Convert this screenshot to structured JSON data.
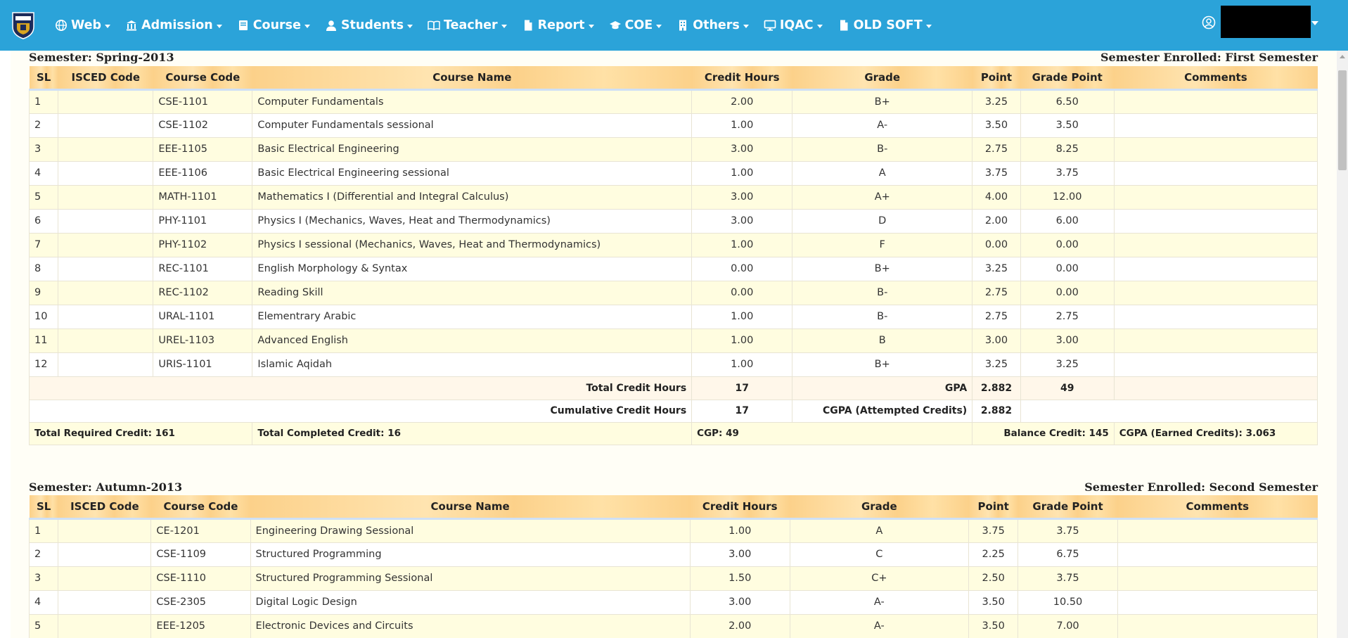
{
  "nav": {
    "items": [
      {
        "label": "Web",
        "icon": "globe-icon"
      },
      {
        "label": "Admission",
        "icon": "institution-icon"
      },
      {
        "label": "Course",
        "icon": "book-icon"
      },
      {
        "label": "Students",
        "icon": "user-icon"
      },
      {
        "label": "Teacher",
        "icon": "open-book-icon"
      },
      {
        "label": "Report",
        "icon": "file-icon"
      },
      {
        "label": "COE",
        "icon": "graduation-cap-icon"
      },
      {
        "label": "Others",
        "icon": "building-icon"
      },
      {
        "label": "IQAC",
        "icon": "desktop-icon"
      },
      {
        "label": "OLD SOFT",
        "icon": "file-icon"
      }
    ]
  },
  "colors": {
    "navbar": "#2ba3d9",
    "header_row": "#fcd18a",
    "odd_row": "#fffde0"
  },
  "columns": [
    "SL",
    "ISCED Code",
    "Course Code",
    "Course Name",
    "Credit Hours",
    "Grade",
    "Point",
    "Grade Point",
    "Comments"
  ],
  "semesters": [
    {
      "label": "Semester: Spring-2013",
      "enrolled": "Semester Enrolled: First Semester",
      "rows": [
        {
          "sl": "1",
          "isced": "",
          "code": "CSE-1101",
          "name": "Computer Fundamentals",
          "credit": "2.00",
          "grade": "B+",
          "point": "3.25",
          "gp": "6.50",
          "comments": ""
        },
        {
          "sl": "2",
          "isced": "",
          "code": "CSE-1102",
          "name": "Computer Fundamentals sessional",
          "credit": "1.00",
          "grade": "A-",
          "point": "3.50",
          "gp": "3.50",
          "comments": ""
        },
        {
          "sl": "3",
          "isced": "",
          "code": "EEE-1105",
          "name": "Basic Electrical Engineering",
          "credit": "3.00",
          "grade": "B-",
          "point": "2.75",
          "gp": "8.25",
          "comments": ""
        },
        {
          "sl": "4",
          "isced": "",
          "code": "EEE-1106",
          "name": "Basic Electrical Engineering sessional",
          "credit": "1.00",
          "grade": "A",
          "point": "3.75",
          "gp": "3.75",
          "comments": ""
        },
        {
          "sl": "5",
          "isced": "",
          "code": "MATH-1101",
          "name": "Mathematics I (Differential and Integral Calculus)",
          "credit": "3.00",
          "grade": "A+",
          "point": "4.00",
          "gp": "12.00",
          "comments": ""
        },
        {
          "sl": "6",
          "isced": "",
          "code": "PHY-1101",
          "name": "Physics I (Mechanics, Waves, Heat and Thermodynamics)",
          "credit": "3.00",
          "grade": "D",
          "point": "2.00",
          "gp": "6.00",
          "comments": ""
        },
        {
          "sl": "7",
          "isced": "",
          "code": "PHY-1102",
          "name": "Physics I sessional (Mechanics, Waves, Heat and Thermodynamics)",
          "credit": "1.00",
          "grade": "F",
          "point": "0.00",
          "gp": "0.00",
          "comments": ""
        },
        {
          "sl": "8",
          "isced": "",
          "code": "REC-1101",
          "name": "English Morphology & Syntax",
          "credit": "0.00",
          "grade": "B+",
          "point": "3.25",
          "gp": "0.00",
          "comments": ""
        },
        {
          "sl": "9",
          "isced": "",
          "code": "REC-1102",
          "name": "Reading Skill",
          "credit": "0.00",
          "grade": "B-",
          "point": "2.75",
          "gp": "0.00",
          "comments": ""
        },
        {
          "sl": "10",
          "isced": "",
          "code": "URAL-1101",
          "name": "Elementrary Arabic",
          "credit": "1.00",
          "grade": "B-",
          "point": "2.75",
          "gp": "2.75",
          "comments": ""
        },
        {
          "sl": "11",
          "isced": "",
          "code": "UREL-1103",
          "name": "Advanced English",
          "credit": "1.00",
          "grade": "B",
          "point": "3.00",
          "gp": "3.00",
          "comments": ""
        },
        {
          "sl": "12",
          "isced": "",
          "code": "URIS-1101",
          "name": "Islamic Aqidah",
          "credit": "1.00",
          "grade": "B+",
          "point": "3.25",
          "gp": "3.25",
          "comments": ""
        }
      ],
      "totals": {
        "total_credit_label": "Total Credit Hours",
        "total_credit": "17",
        "gpa_label": "GPA",
        "gpa": "2.882",
        "gpa_points": "49",
        "cum_credit_label": "Cumulative Credit Hours",
        "cum_credit": "17",
        "cgpa_attempted_label": "CGPA (Attempted Credits)",
        "cgpa_attempted": "2.882"
      },
      "summary": {
        "required": "Total Required Credit: 161",
        "completed": "Total Completed Credit: 16",
        "cgp": "CGP: 49",
        "balance": "Balance Credit: 145",
        "cgpa_earned": "CGPA (Earned Credits): 3.063"
      }
    },
    {
      "label": "Semester: Autumn-2013",
      "enrolled": "Semester Enrolled: Second Semester",
      "rows": [
        {
          "sl": "1",
          "isced": "",
          "code": "CE-1201",
          "name": "Engineering Drawing Sessional",
          "credit": "1.00",
          "grade": "A",
          "point": "3.75",
          "gp": "3.75",
          "comments": ""
        },
        {
          "sl": "2",
          "isced": "",
          "code": "CSE-1109",
          "name": "Structured Programming",
          "credit": "3.00",
          "grade": "C",
          "point": "2.25",
          "gp": "6.75",
          "comments": ""
        },
        {
          "sl": "3",
          "isced": "",
          "code": "CSE-1110",
          "name": "Structured Programming Sessional",
          "credit": "1.50",
          "grade": "C+",
          "point": "2.50",
          "gp": "3.75",
          "comments": ""
        },
        {
          "sl": "4",
          "isced": "",
          "code": "CSE-2305",
          "name": "Digital Logic Design",
          "credit": "3.00",
          "grade": "A-",
          "point": "3.50",
          "gp": "10.50",
          "comments": ""
        },
        {
          "sl": "5",
          "isced": "",
          "code": "EEE-1205",
          "name": "Electronic Devices and Circuits",
          "credit": "2.00",
          "grade": "A-",
          "point": "3.50",
          "gp": "7.00",
          "comments": ""
        }
      ]
    }
  ]
}
